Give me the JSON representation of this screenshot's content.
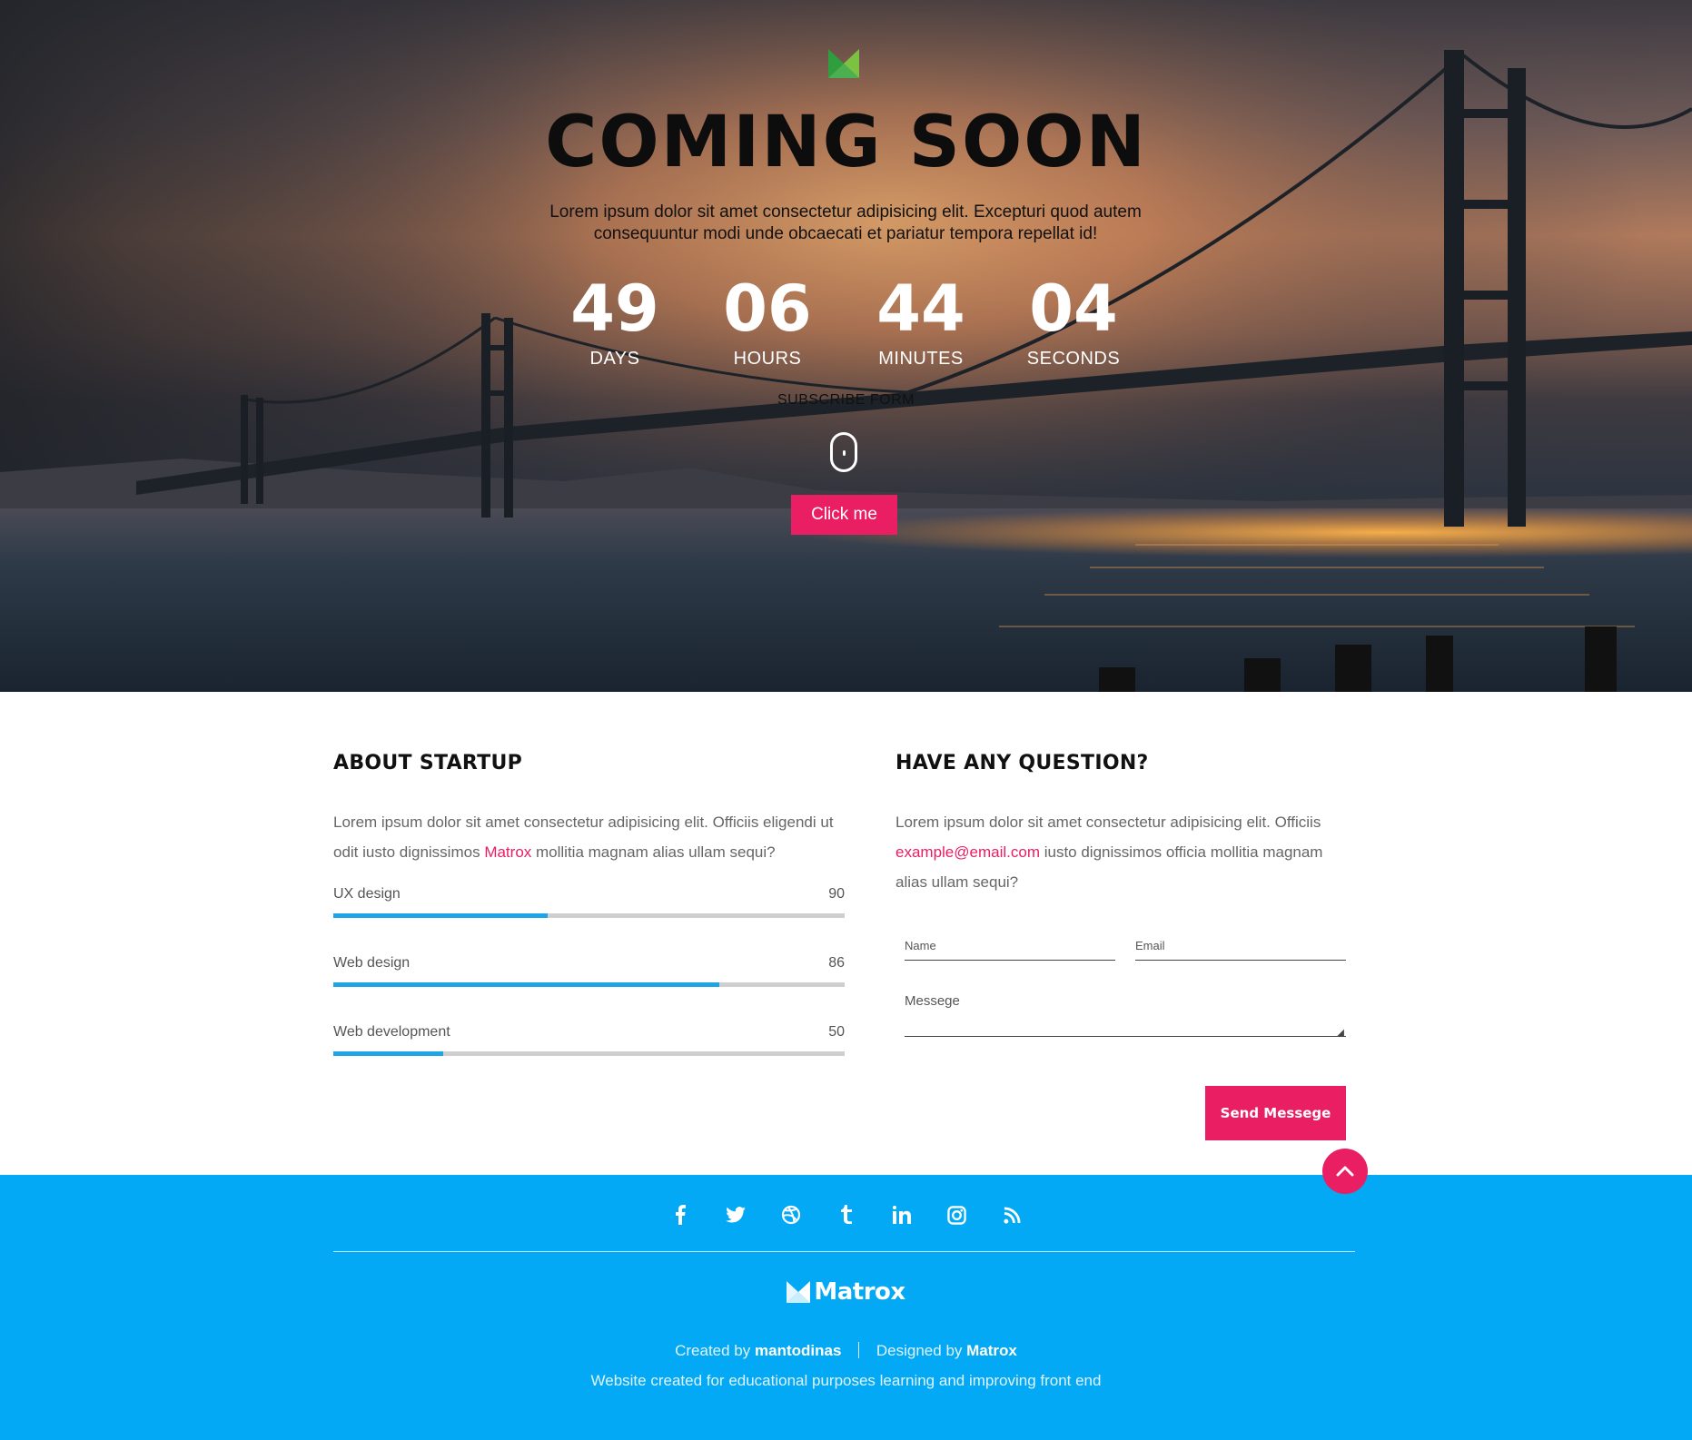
{
  "hero": {
    "title": "COMING SOON",
    "description": "Lorem ipsum dolor sit amet consectetur adipisicing elit. Excepturi quod autem consequuntur modi unde obcaecati et pariatur tempora repellat id!",
    "countdown": [
      {
        "value": "49",
        "label": "DAYS"
      },
      {
        "value": "06",
        "label": "HOURS"
      },
      {
        "value": "44",
        "label": "MINUTES"
      },
      {
        "value": "04",
        "label": "SECONDS"
      }
    ],
    "subscribe_label": "SUBSCRIBE FORM",
    "button_label": "Click me",
    "logo_icon": "matrox-logo-icon"
  },
  "about": {
    "title": "ABOUT STARTUP",
    "text_before": "Lorem ipsum dolor sit amet consectetur adipisicing elit. Officiis eligendi ut odit iusto dignissimos ",
    "link_text": "Matrox",
    "text_after": " mollitia magnam alias ullam sequi?",
    "skills": [
      {
        "name": "UX design",
        "value": 90,
        "fill_fraction": 0.42
      },
      {
        "name": "Web design",
        "value": 86,
        "fill_fraction": 0.754
      },
      {
        "name": "Web development",
        "value": 50,
        "fill_fraction": 0.215
      }
    ]
  },
  "question": {
    "title": "HAVE ANY QUESTION?",
    "text_before": "Lorem ipsum dolor sit amet consectetur adipisicing elit. Officiis ",
    "email": "example@email.com",
    "text_after": " iusto dignissimos officia mollitia magnam alias ullam sequi?",
    "form": {
      "name_placeholder": "Name",
      "email_placeholder": "Email",
      "message_placeholder": "Messege",
      "send_label": "Send Messege"
    }
  },
  "footer": {
    "social_icons": [
      "facebook-icon",
      "twitter-icon",
      "dribbble-icon",
      "tumblr-icon",
      "linkedin-icon",
      "instagram-icon",
      "rss-icon"
    ],
    "brand": "Matrox",
    "created_by_label": "Created by",
    "created_by_name": "mantodinas",
    "designed_by_label": "Designed by",
    "designed_by_name": "Matrox",
    "tagline": "Website created for educational purposes learning and improving front end"
  },
  "colors": {
    "accent": "#e91e63",
    "footer_blue": "#03a9f4",
    "progress_blue": "#1ea5e6",
    "logo_green": "#4caf50"
  }
}
